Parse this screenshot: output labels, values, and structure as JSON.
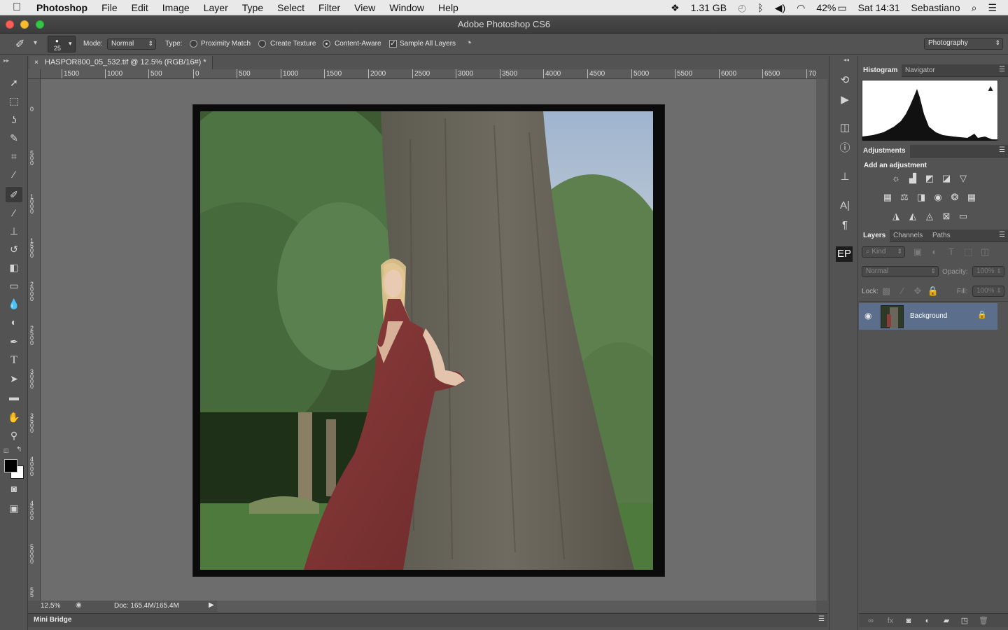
{
  "menubar": {
    "app": "Photoshop",
    "items": [
      "File",
      "Edit",
      "Image",
      "Layer",
      "Type",
      "Select",
      "Filter",
      "View",
      "Window",
      "Help"
    ],
    "status": {
      "memory": "1.31 GB",
      "battery": "42%",
      "clock": "Sat 14:31",
      "user": "Sebastiano"
    },
    "icons": [
      "dropbox-icon",
      "time-machine-icon",
      "bluetooth-icon",
      "volume-icon",
      "wifi-icon",
      "battery-icon",
      "spotlight-icon",
      "notification-center-icon"
    ]
  },
  "window": {
    "title": "Adobe Photoshop CS6"
  },
  "options": {
    "brush_size": "25",
    "mode_label": "Mode:",
    "mode_value": "Normal",
    "type_label": "Type:",
    "type_options": [
      "Proximity Match",
      "Create Texture",
      "Content-Aware"
    ],
    "selected_type": "Content-Aware",
    "sample_all": "Sample All Layers",
    "sample_all_checked": true,
    "workspace": "Photography"
  },
  "document": {
    "tab_title": "HASPOR800_05_532.tif @ 12.5% (RGB/16#) *",
    "zoom": "12.5%",
    "doc_size": "Doc: 165.4M/165.4M",
    "ruler_top": [
      "1500",
      "1000",
      "500",
      "0",
      "500",
      "1000",
      "1500",
      "2000",
      "2500",
      "3000",
      "3500",
      "4000",
      "4500",
      "5000",
      "5500",
      "6000",
      "6500",
      "70"
    ],
    "ruler_left": [
      "0",
      "500",
      "1000",
      "1500",
      "2000",
      "2500",
      "3000",
      "3500",
      "4000",
      "4500",
      "5000",
      "55"
    ]
  },
  "bottom_panel": {
    "label": "Mini Bridge"
  },
  "panels": {
    "top_tabs": [
      "Histogram",
      "Navigator"
    ],
    "adjustments_tab": "Adjustments",
    "adjustments_hint": "Add an adjustment",
    "layer_tabs": [
      "Layers",
      "Channels",
      "Paths"
    ],
    "kind": "Kind",
    "blend_mode": "Normal",
    "opacity_label": "Opacity:",
    "opacity_value": "100%",
    "lock_label": "Lock:",
    "fill_label": "Fill:",
    "fill_value": "100%",
    "layers": [
      {
        "name": "Background",
        "visible": true,
        "locked": true
      }
    ]
  },
  "dock": {
    "ep_label": "EP"
  },
  "colors": {
    "accent_selected_layer": "#5b6f8d",
    "foreground": "#000000",
    "background": "#ffffff"
  }
}
